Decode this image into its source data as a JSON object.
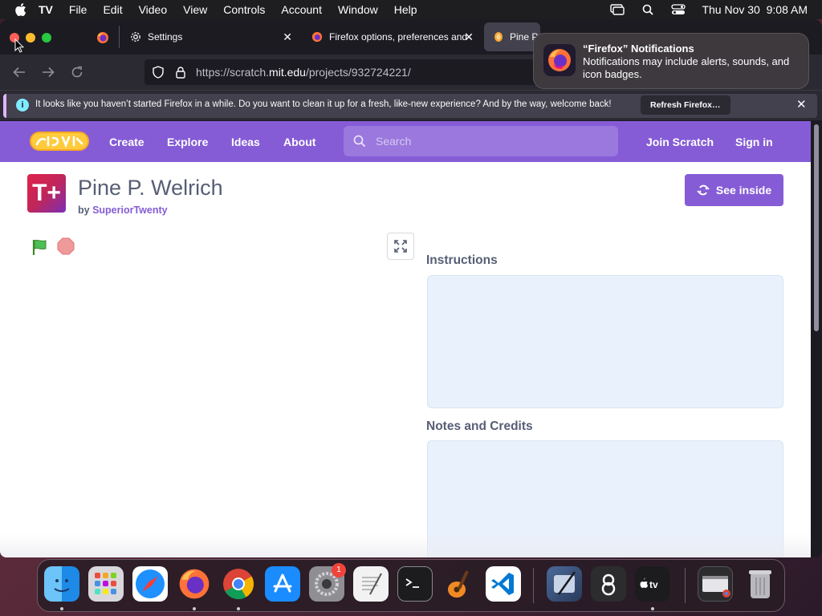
{
  "menubar": {
    "app_name": "TV",
    "items": [
      "File",
      "Edit",
      "Video",
      "View",
      "Controls",
      "Account",
      "Window",
      "Help"
    ],
    "clock": "Thu Nov 30  9:08 AM"
  },
  "tabs": {
    "settings": "Settings",
    "firefox_options": "Firefox options, preferences and",
    "active": "Pine P"
  },
  "url": {
    "prefix": "https://scratch.",
    "domain": "mit.edu",
    "path": "/projects/932724221/"
  },
  "infobar": {
    "message": "It looks like you haven’t started Firefox in a while. Do you want to clean it up for a fresh, like-new experience? And by the way, welcome back!",
    "button": "Refresh Firefox…"
  },
  "scratch_nav": {
    "create": "Create",
    "explore": "Explore",
    "ideas": "Ideas",
    "about": "About",
    "search_placeholder": "Search",
    "join": "Join Scratch",
    "signin": "Sign in"
  },
  "project": {
    "thumb_text": "T+",
    "title": "Pine P. Welrich",
    "by_label": "by",
    "author": "SuperiorTwenty",
    "see_inside": "See inside",
    "instructions_heading": "Instructions",
    "notes_heading": "Notes and Credits"
  },
  "notification": {
    "title": "“Firefox” Notifications",
    "body": "Notifications may include alerts, sounds, and icon badges."
  },
  "dock": {
    "badge_count": "1",
    "apps": [
      "finder-icon",
      "launchpad-icon",
      "safari-icon",
      "firefox-icon",
      "chrome-icon",
      "app-store-icon",
      "system-settings-icon",
      "textedit-icon",
      "terminal-icon",
      "garageband-icon",
      "vscode-icon",
      "scripteditor-icon",
      "gpt-icon",
      "apple-tv-icon",
      "chrome-window-icon",
      "trash-icon"
    ]
  },
  "colors": {
    "scratch_purple": "#855cd6",
    "firefox_dark": "#1c1b22",
    "info_accent": "#e0b4ff"
  }
}
